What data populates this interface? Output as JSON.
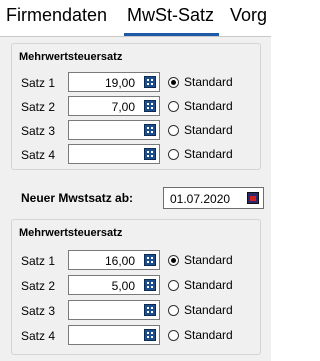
{
  "tabs": [
    {
      "label": "Firmendaten"
    },
    {
      "label": "MwSt-Satz"
    },
    {
      "label": "Vorg"
    }
  ],
  "group1": {
    "title": "Mehrwertsteuersatz",
    "rows": [
      {
        "label": "Satz 1",
        "value": "19,00",
        "radio_label": "Standard",
        "checked": true
      },
      {
        "label": "Satz 2",
        "value": "7,00",
        "radio_label": "Standard",
        "checked": false
      },
      {
        "label": "Satz 3",
        "value": "",
        "radio_label": "Standard",
        "checked": false
      },
      {
        "label": "Satz 4",
        "value": "",
        "radio_label": "Standard",
        "checked": false
      }
    ]
  },
  "new_rate": {
    "label": "Neuer Mwstsatz ab:",
    "date": "01.07.2020"
  },
  "group2": {
    "title": "Mehrwertsteuersatz",
    "rows": [
      {
        "label": "Satz 1",
        "value": "16,00",
        "radio_label": "Standard",
        "checked": true
      },
      {
        "label": "Satz 2",
        "value": "5,00",
        "radio_label": "Standard",
        "checked": false
      },
      {
        "label": "Satz 3",
        "value": "",
        "radio_label": "Standard",
        "checked": false
      },
      {
        "label": "Satz 4",
        "value": "",
        "radio_label": "Standard",
        "checked": false
      }
    ]
  }
}
